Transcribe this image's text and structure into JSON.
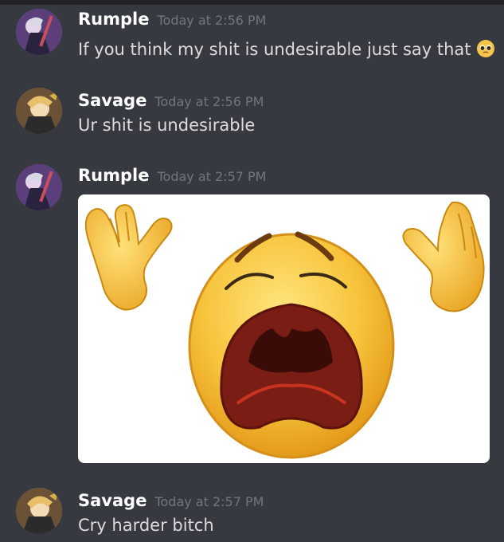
{
  "messages": [
    {
      "username": "Rumple",
      "timestamp": "Today at 2:56 PM",
      "text": "If you think my shit is undesirable just say that",
      "emoji": "pleading-face-emoji"
    },
    {
      "username": "Savage",
      "timestamp": "Today at 2:56 PM",
      "text": "Ur shit is undesirable"
    },
    {
      "username": "Rumple",
      "timestamp": "Today at 2:57 PM",
      "image": "crying-emoji-with-raised-hands"
    },
    {
      "username": "Savage",
      "timestamp": "Today at 2:57 PM",
      "text": "Cry harder bitch"
    }
  ],
  "colors": {
    "background": "#36393f",
    "username": "#ffffff",
    "timestamp": "#72767d",
    "message_text": "#dcddde"
  }
}
